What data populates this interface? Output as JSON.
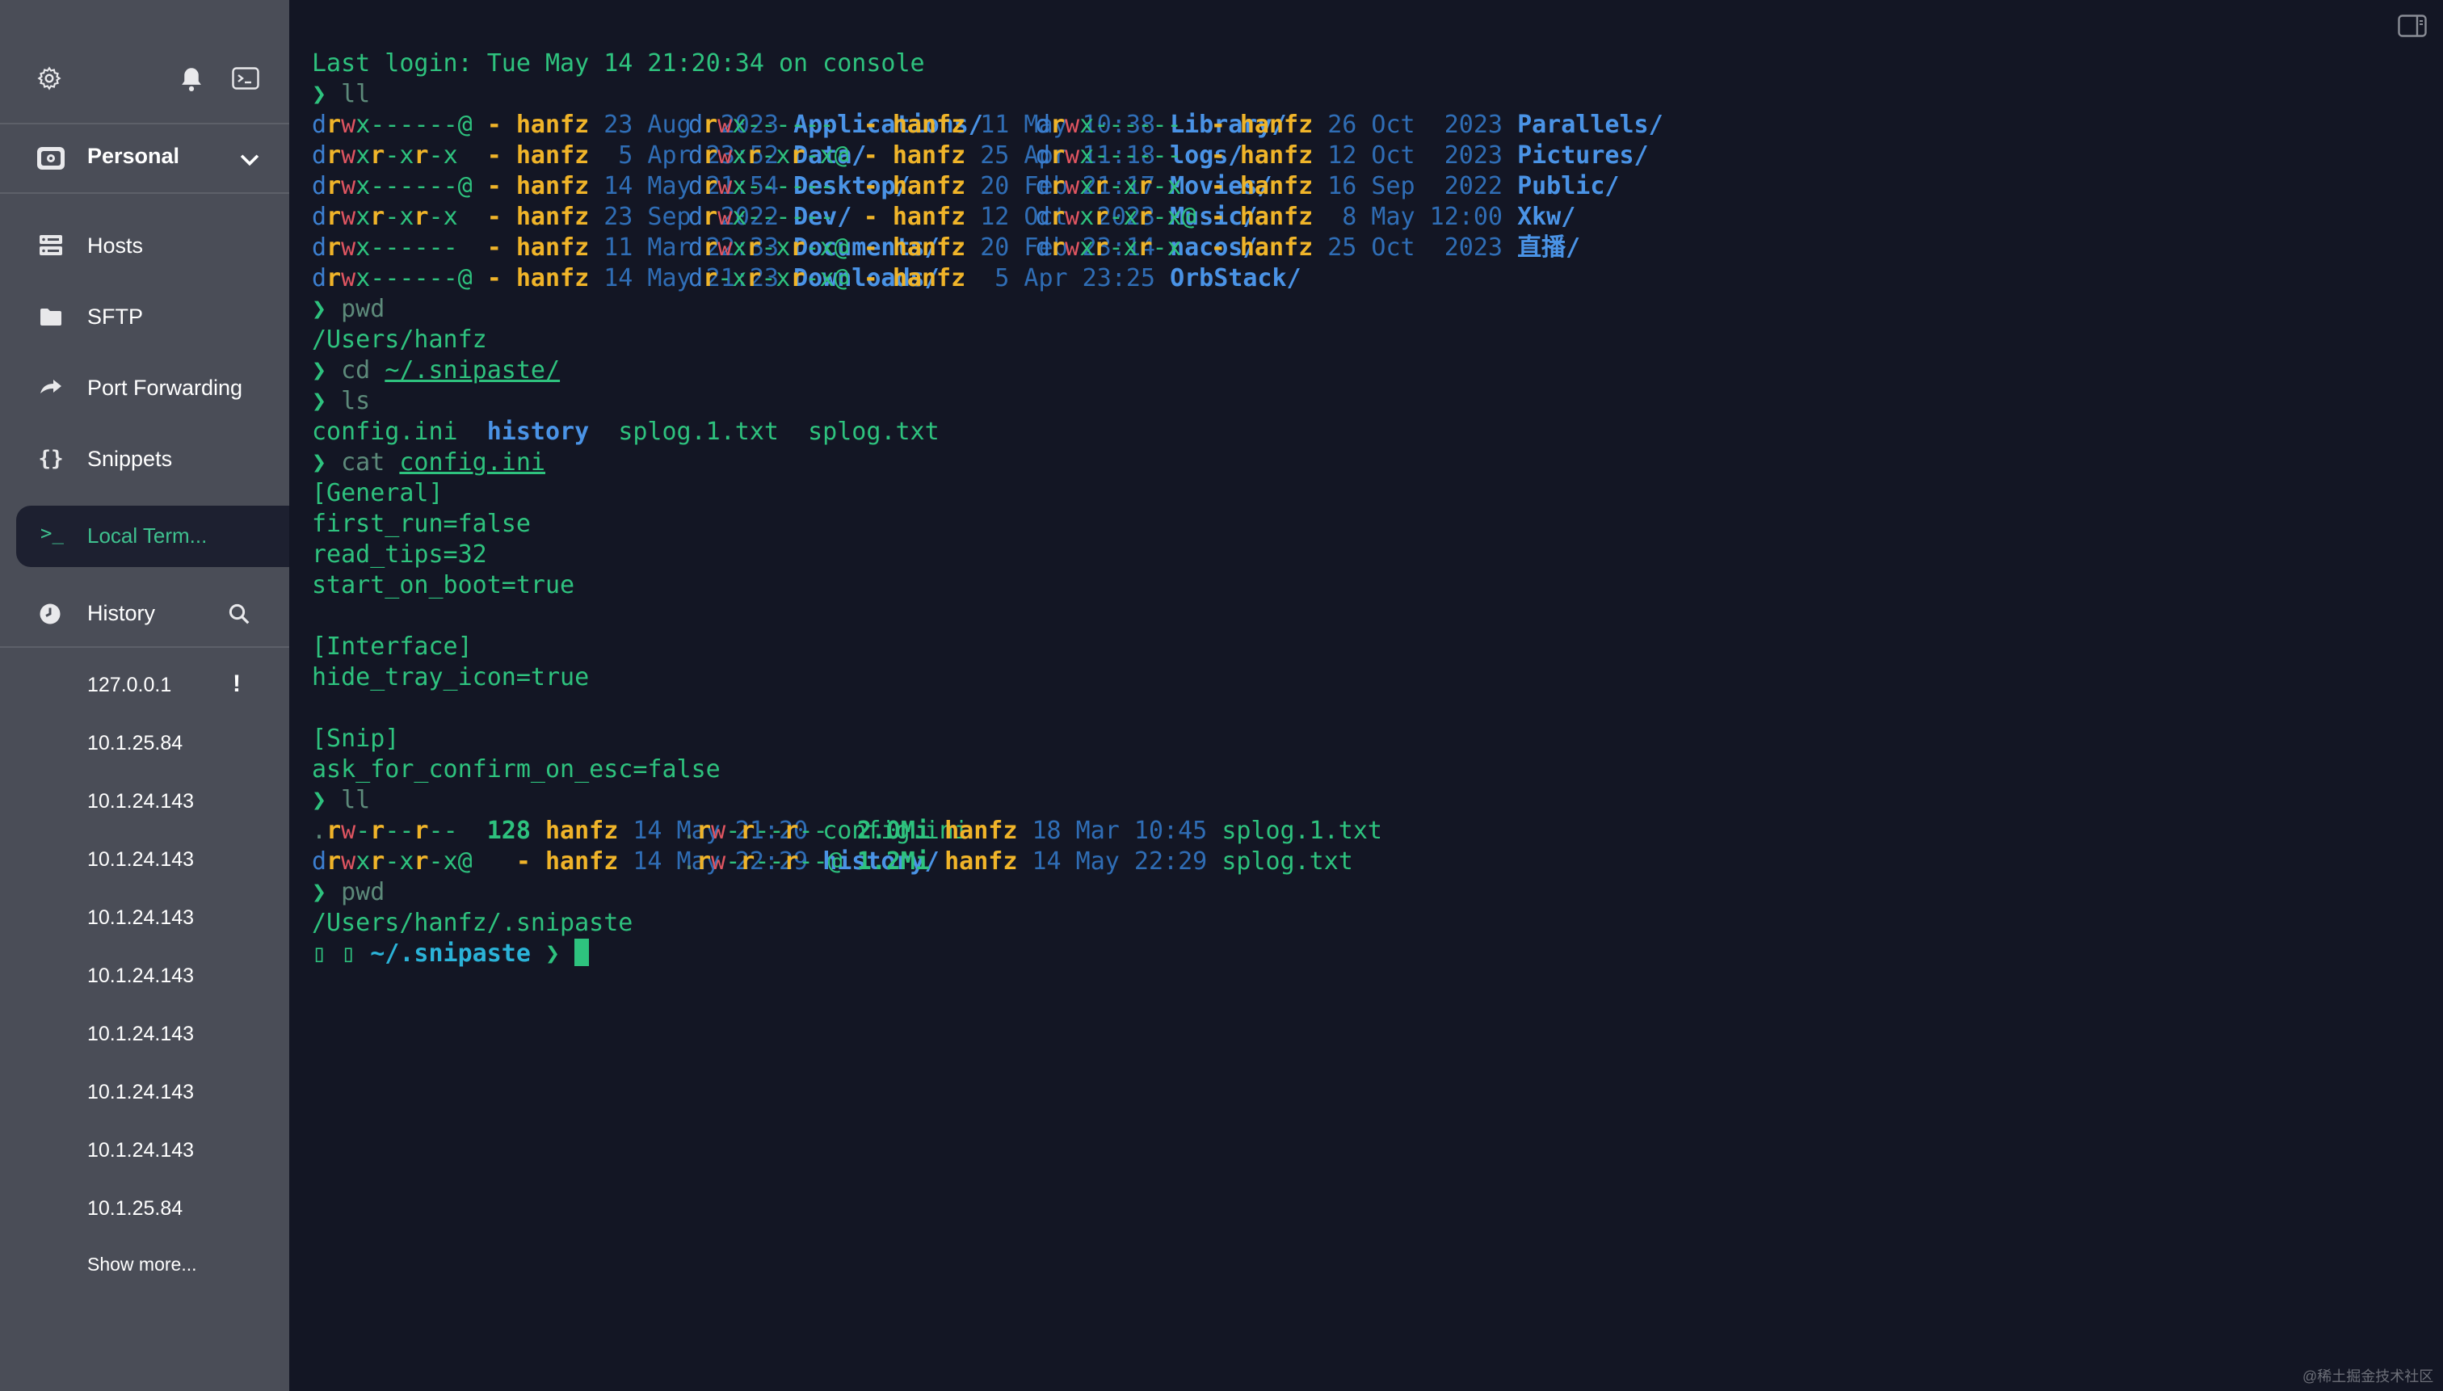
{
  "sidebar": {
    "vault_label": "Personal",
    "nav": [
      {
        "label": "Hosts",
        "icon": "hosts-icon"
      },
      {
        "label": "SFTP",
        "icon": "folder-icon"
      },
      {
        "label": "Port Forwarding",
        "icon": "port-forwarding-icon"
      },
      {
        "label": "Snippets",
        "icon": "snippets-icon"
      }
    ],
    "active_terminal_label": "Local Term...",
    "history_label": "History",
    "history_items": [
      "127.0.0.1",
      "10.1.25.84",
      "10.1.24.143",
      "10.1.24.143",
      "10.1.24.143",
      "10.1.24.143",
      "10.1.24.143",
      "10.1.24.143",
      "10.1.24.143",
      "10.1.25.84"
    ],
    "show_more": "Show more..."
  },
  "terminal": {
    "last_login": "Last login: Tue May 14 21:20:34 on console",
    "prompt_char": "❯",
    "cmd_ll": "ll",
    "listing_rows": [
      [
        {
          "perm": "drwx------@",
          "size": "-",
          "user": "hanfz",
          "date": "23 Aug  2023",
          "name": "Applications/"
        },
        {
          "perm": "drwx------ ",
          "size": "-",
          "user": "hanfz",
          "date": "11 May 10:38",
          "name": "Library/"
        },
        {
          "perm": "drwx------ ",
          "size": "-",
          "user": "hanfz",
          "date": "26 Oct  2023",
          "name": "Parallels/"
        }
      ],
      [
        {
          "perm": "drwxr-xr-x ",
          "size": "-",
          "user": "hanfz",
          "date": " 5 Apr 23:52",
          "name": "Data/"
        },
        {
          "perm": "drwxr-xr-x@",
          "size": "-",
          "user": "hanfz",
          "date": "25 Apr 11:18",
          "name": "logs/"
        },
        {
          "perm": "drwx------ ",
          "size": "-",
          "user": "hanfz",
          "date": "12 Oct  2023",
          "name": "Pictures/"
        }
      ],
      [
        {
          "perm": "drwx------@",
          "size": "-",
          "user": "hanfz",
          "date": "14 May 21:54",
          "name": "Desktop/"
        },
        {
          "perm": "drwx------ ",
          "size": "-",
          "user": "hanfz",
          "date": "20 Feb 21:17",
          "name": "Movies/"
        },
        {
          "perm": "drwxr-xr-x ",
          "size": "-",
          "user": "hanfz",
          "date": "16 Sep  2022",
          "name": "Public/"
        }
      ],
      [
        {
          "perm": "drwxr-xr-x ",
          "size": "-",
          "user": "hanfz",
          "date": "23 Sep  2022",
          "name": "Dev/"
        },
        {
          "perm": "drwx------ ",
          "size": "-",
          "user": "hanfz",
          "date": "12 Oct  2023",
          "name": "Music/"
        },
        {
          "perm": "drwxr-xr-x@",
          "size": "-",
          "user": "hanfz",
          "date": " 8 May 12:00",
          "name": "Xkw/"
        }
      ],
      [
        {
          "perm": "drwx------ ",
          "size": "-",
          "user": "hanfz",
          "date": "11 Mar 22:33",
          "name": "Documents/"
        },
        {
          "perm": "drwxr-xr-x@",
          "size": "-",
          "user": "hanfz",
          "date": "20 Feb 23:14",
          "name": "nacos/"
        },
        {
          "perm": "drwxr-xr-x ",
          "size": "-",
          "user": "hanfz",
          "date": "25 Oct  2023",
          "name": "直播/"
        }
      ],
      [
        {
          "perm": "drwx------@",
          "size": "-",
          "user": "hanfz",
          "date": "14 May 21:23",
          "name": "Downloads/"
        },
        {
          "perm": "dr-xr-xr-x@",
          "size": "-",
          "user": "hanfz",
          "date": " 5 Apr 23:25",
          "name": "OrbStack/"
        }
      ]
    ],
    "cmd_pwd": "pwd",
    "pwd_home": "/Users/hanfz",
    "cmd_cd": "cd",
    "cd_arg": "~/.snipaste/",
    "cmd_ls": "ls",
    "ls_files": [
      "config.ini",
      "history",
      "splog.1.txt",
      "splog.txt"
    ],
    "cmd_cat": "cat",
    "cat_arg": "config.ini",
    "config_lines": [
      "[General]",
      "first_run=false",
      "read_tips=32",
      "start_on_boot=true",
      "",
      "[Interface]",
      "hide_tray_icon=true",
      "",
      "[Snip]",
      "ask_for_confirm_on_esc=false"
    ],
    "ll2_rows": [
      [
        {
          "perm": ".rw-r--r-- ",
          "size": "128",
          "user": "hanfz",
          "date": "14 May 21:20",
          "name": "config.ini"
        },
        {
          "perm": ".rw-r--r-- ",
          "size": "2.0Mi",
          "user": "hanfz",
          "date": "18 Mar 10:45",
          "name": "splog.1.txt"
        }
      ],
      [
        {
          "perm": "drwxr-xr-x@",
          "size": "-",
          "user": "hanfz",
          "date": "14 May 22:29",
          "name": "history/"
        },
        {
          "perm": ".rw-r--r--@",
          "size": "1.2Mi",
          "user": "hanfz",
          "date": "14 May 22:29",
          "name": "splog.txt"
        }
      ]
    ],
    "pwd_snipaste": "/Users/hanfz/.snipaste",
    "final_prompt_prefix": "▯ ▯ ",
    "final_prompt_path": "~/.snipaste",
    "final_prompt_char": " ❯ "
  },
  "watermark": "@稀土掘金技术社区"
}
